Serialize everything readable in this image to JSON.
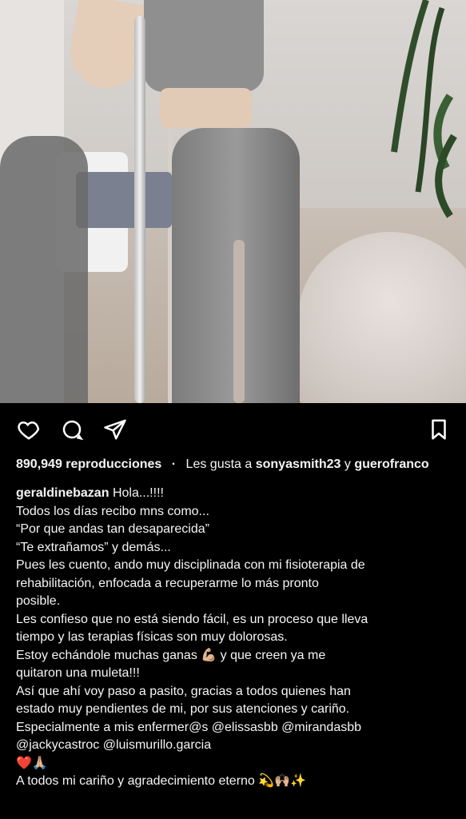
{
  "post": {
    "views_text": "890,949 reproducciones",
    "likes_prefix": "Les gusta a",
    "liked_by_primary": "sonyasmith23",
    "liked_by_connector": "y",
    "liked_by_secondary": "guerofranco"
  },
  "icons": {
    "like": "heart-icon",
    "comment": "comment-icon",
    "share": "send-icon",
    "save": "bookmark-icon"
  },
  "caption": {
    "username": "geraldinebazan",
    "first_line": "Hola...!!!!",
    "lines": [
      "Todos los días recibo mns como...",
      "“Por que andas tan desaparecida”",
      "“Te extrañamos” y demás...",
      "Pues les cuento, ando muy disciplinada con mi fisioterapia de",
      "rehabilitación, enfocada a recuperarme lo más pronto",
      "posible.",
      "Les confieso que no está siendo fácil, es un proceso que lleva",
      "tiempo y las terapias físicas son muy dolorosas.",
      "Estoy echándole muchas ganas 💪🏼 y que creen ya me",
      "quitaron una muleta!!!",
      "Así que ahí voy paso a pasito, gracias a todos quienes han",
      "estado muy pendientes de mi, por sus atenciones y cariño.",
      "Especialmente a mis enfermer@s @elissasbb @mirandasbb",
      "@jackycastroc @luismurillo.garcia",
      "❤️🙏🏼",
      "A todos mi cariño y agradecimiento eterno 💫🙌🏼✨"
    ]
  }
}
